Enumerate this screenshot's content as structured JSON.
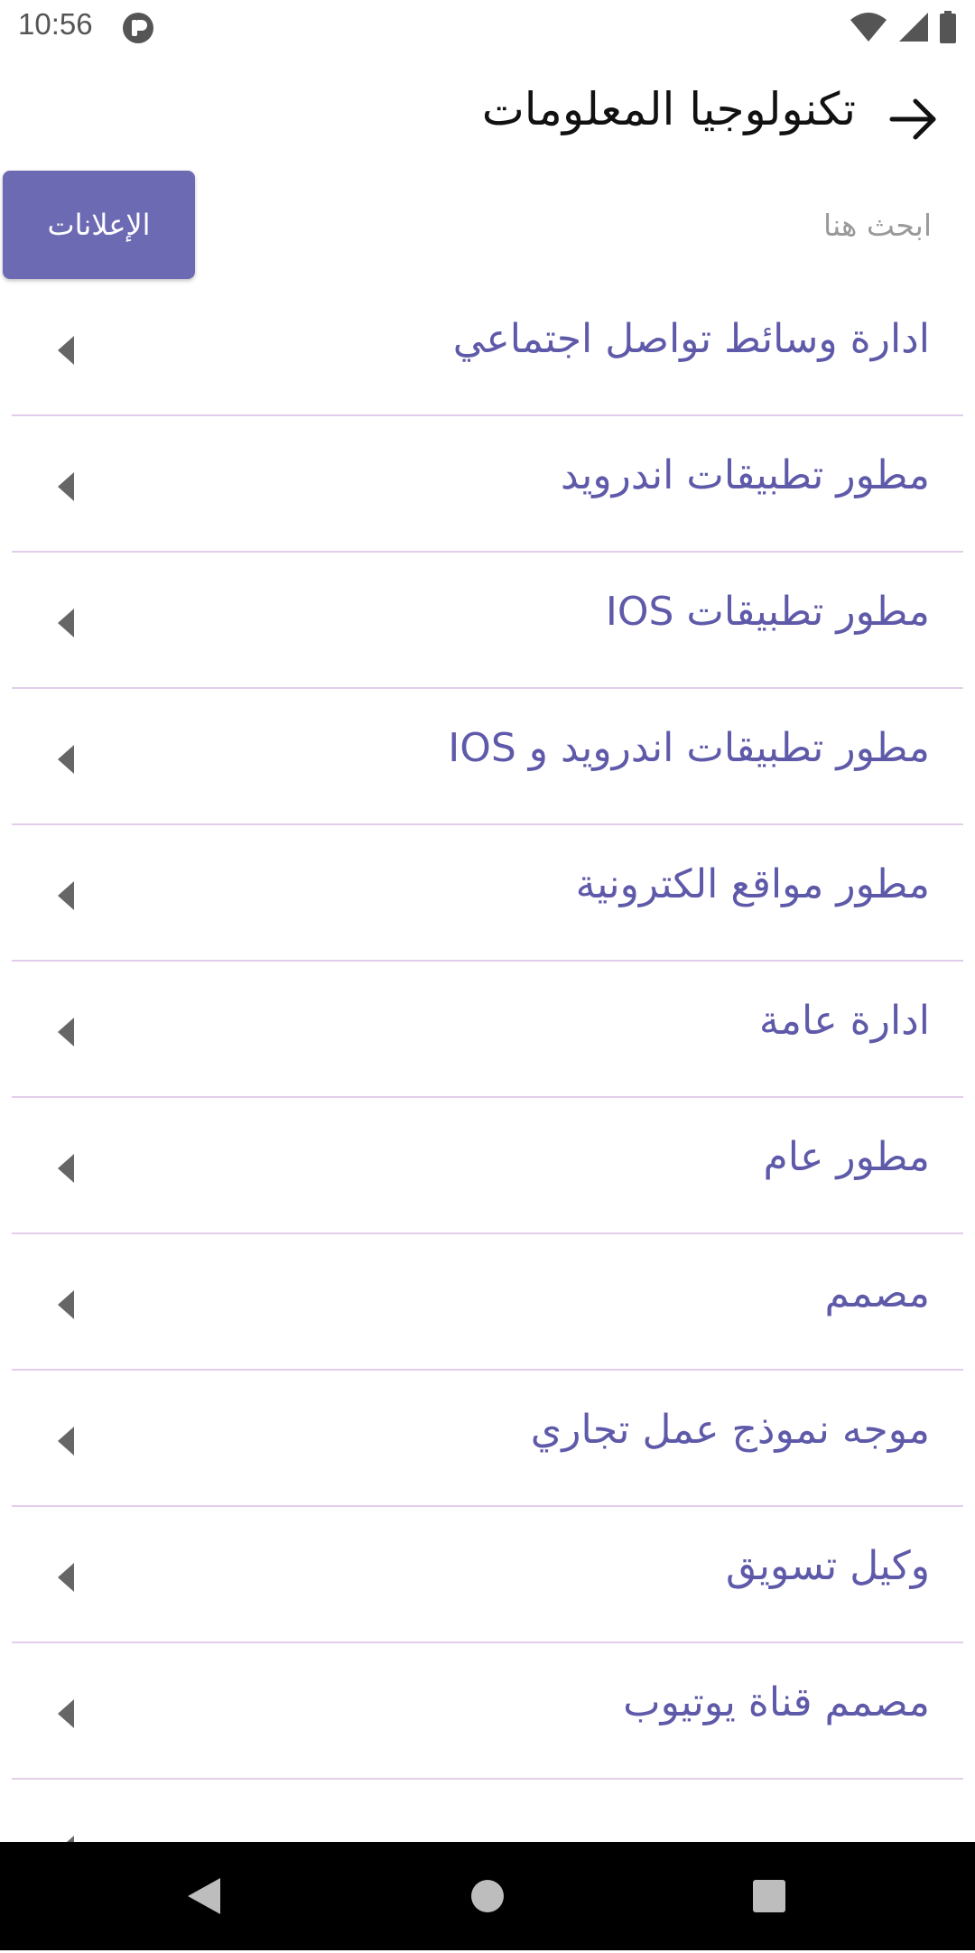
{
  "status_bar": {
    "time": "10:56",
    "icons": [
      "notification-icon",
      "wifi-icon",
      "signal-icon",
      "battery-icon"
    ]
  },
  "app_bar": {
    "title": "تكنولوجيا المعلومات",
    "back_icon": "arrow-right-icon"
  },
  "search": {
    "placeholder": "ابحث هنا",
    "ads_button_label": "الإعلانات"
  },
  "categories": [
    {
      "label": "ادارة وسائط تواصل اجتماعي"
    },
    {
      "label": "مطور تطبيقات اندرويد"
    },
    {
      "label": "مطور تطبيقات IOS"
    },
    {
      "label": "مطور تطبيقات اندرويد و IOS"
    },
    {
      "label": "مطور مواقع الكترونية"
    },
    {
      "label": "ادارة عامة"
    },
    {
      "label": "مطور عام"
    },
    {
      "label": "مصمم"
    },
    {
      "label": "موجه نموذج عمل تجاري"
    },
    {
      "label": "وكيل تسويق"
    },
    {
      "label": "مصمم قناة يوتيوب"
    },
    {
      "label": ""
    }
  ],
  "colors": {
    "accent": "#6d6ab4",
    "item_text": "#5e5aa9",
    "divider": "#e4cdeb"
  },
  "nav_bar": {
    "icons": [
      "back-triangle-icon",
      "home-circle-icon",
      "recents-square-icon"
    ]
  }
}
